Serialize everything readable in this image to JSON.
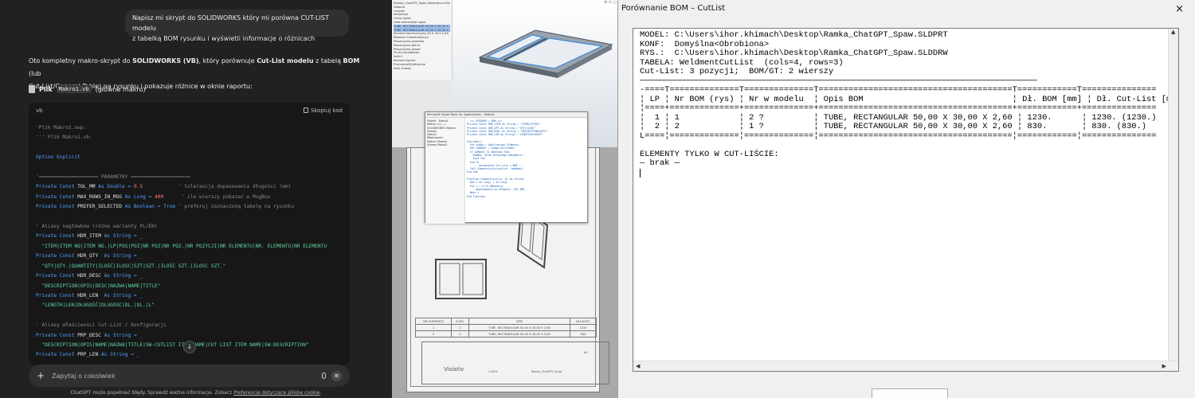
{
  "chat": {
    "user_message_line1": "Napisz mi skrypt do SOLIDWORKS który mi porówna CUT-LIST modelu",
    "user_message_line2": "z tabelką BOM rysunku i wyświetli informacje o różnicach",
    "intro_p1": "Oto kompletny makro-skrypt do ",
    "intro_b1": "SOLIDWORKS (VB)",
    "intro_p2": ", który porównuje ",
    "intro_b2": "Cut-List modelu",
    "intro_p3": " z tabelą ",
    "intro_b3": "BOM",
    "intro_p4": " (lub",
    "intro_line2": "Cut-List/General Table) na rysunku i pokazuje różnice w oknie raportu:",
    "file_label": "Plik",
    "file_name": "Makro1.vb",
    "file_note": "(główne makro)",
    "code_lang": "vb",
    "copy_label": "Skopiuj kod",
    "code_lines": {
      "l01": "'Plik Makro1.swp:",
      "l02": "''' Plik Makro1.vb:",
      "l03": "Option Explicit",
      "l04": "'==================== PARAMETRY ====================",
      "l05a": "Private Const ",
      "l05b": "TOL_MM",
      "l05c": " As Double = ",
      "l05d": "0.5",
      "l05e": "            ' tolerancja dopasowania długości (mm)",
      "l06a": "Private Const ",
      "l06b": "MAX_ROWS_IN_MSG",
      "l06c": " As Long = ",
      "l06d": "400",
      "l06e": "      ' ile wierszy pokazać w MsgBox",
      "l07a": "Private Const ",
      "l07b": "PREFER_SELECTED",
      "l07c": " As Boolean = ",
      "l07d": "True",
      "l07e": " ' preferuj zaznaczoną tabelę na rysunku",
      "l08": "' Aliasy nagłówków (różne warianty PL/EN)",
      "l09a": "Private Const ",
      "l09b": "HDR_ITEM",
      "l09c": " As String = _",
      "l10": "  \"ITEM|ITEM NO|ITEM NO.|LP|POS|POZ|NR POZ|NR POZ.|NR POZYCJI|NR ELEMENTU|NR. ELEMENTU|NR ELEMENTU",
      "l11a": "Private Const ",
      "l11b": "HDR_QTY",
      "l11c": "  As String = _",
      "l12": "  \"QTY|QTY.|QUANTITY|ILOŚĆ|ILOSC|SZT|SZT.|ILOŚĆ SZT.|ILOSC SZT.\"",
      "l13a": "Private Const ",
      "l13b": "HDR_DESC",
      "l13c": " As String = _",
      "l14": "  \"DESCRIPTION|OPIS|DESC|NAZWA|NAME|TITLE\"",
      "l15a": "Private Const ",
      "l15b": "HDR_LEN",
      "l15c": "  As String = _",
      "l16": "  \"LENGTH|LEN|DŁUGOŚĆ|DLUGOSC|DL.|DL.|L\"",
      "l17": "' Aliasy właściwości Cut-List / konfiguracji",
      "l18a": "Private Const ",
      "l18b": "PRP_DESC",
      "l18c": " As String = _",
      "l19": "  \"DESCRIPTION|OPIS|NAME|NAZWA|TITLE|SW-CUTLIST ITEM NAME|CUT LIST ITEM NAME|SW-DESCRIPTION\"",
      "l20a": "Private Const ",
      "l20b": "PRP_LEN",
      "l20c": " As String = _"
    },
    "composer_placeholder": "Zapytaj o cokolwiek",
    "disclaimer_text": "ChatGPT może popełniać błędy. Sprawdź ważne informacje. Zobacz ",
    "disclaimer_link": "Preferencje dotyczące plików cookie",
    "disclaimer_end": "."
  },
  "solidworks": {
    "tree_items": [
      "Ramka_ChatGPT_Spaw (Domyślna<Obrobiona>)",
      "Historia",
      "Czujniki",
      "Adnotacje",
      "Cechy spaw.",
      "Lista elementów spaw.",
      "TUBE, RECTANGULAR 50,00 X 30,00 X 2,60(1)",
      "TUBE, RECTANGULAR 50,00 X 30,00 X 2,60(2)",
      "Element konstrukcyjny 50 X 30 X 2,60",
      "Materiał <nieokreślony>",
      "Płaszczyzna przednia",
      "Płaszczyzna górna",
      "Płaszczyzna prawa",
      "Punkt początkowy",
      "Szkic1",
      "Element konstr.",
      "Przycięcie/Wydłużenie",
      "Szyk liniowy"
    ],
    "macro_title": "Microsoft Visual Basic for Applications - Makro1",
    "macro_left": [
      "Projekt - Makro1",
      "Makro1 (c:\\...)",
      "SOLIDWORKS Objects",
      "Moduły",
      "Makro1",
      "Właściwości",
      "Makro1 Module",
      "(Name) Makro1"
    ],
    "macro_code": [
      "' === RYSUNEK / BOM ===",
      "Private Const HDR_ITEM As String = \"ITEM|LP|POS\"",
      "Private Const HDR_QTY As String = \"QTY|ILOSC\"",
      "Private Const HDR_DESC As String = \"DESCRIPTION|OPIS\"",
      "Private Const HDR_LEN As String = \"LENGTH|DLUGOSC\"",
      "",
      "Sub main()",
      "  Set swApp = Application.SldWorks",
      "  Set swModel = swApp.ActiveDoc",
      "  If swModel Is Nothing Then",
      "    MsgBox \"Brak aktywnego dokumentu.\"",
      "    Exit Sub",
      "  End If",
      "  ' ... porównanie Cut-List z BOM ...",
      "  Call CompareLists(cutList, bomRows)",
      "End Sub",
      "",
      "Function CompareLists(a, b) As String",
      "  Dim i As Long, j As Long",
      "  For i = 0 To UBound(a)",
      "    ' dopasowanie po długości (TOL_MM)",
      "  Next i",
      "End Function"
    ],
    "bom_header": [
      "NR ELEMENTU",
      "ILOŚĆ",
      "OPIS",
      "DŁUGOŚĆ"
    ],
    "bom_rows": [
      [
        "1",
        "2",
        "TUBE, RECTANGULAR 50,00 X 30,00 X 2,60",
        "1230"
      ],
      [
        "2",
        "2",
        "TUBE, RECTANGULAR 50,00 X 30,00 X 2,60",
        "830"
      ]
    ],
    "title_block_logo": "Visiativ",
    "title_block_name": "Ramka_ChatGPT_Spaw",
    "title_block_code": "L.0001",
    "title_block_scale": "A4"
  },
  "dialog": {
    "title": "Porównanie BOM – CutList",
    "close_glyph": "×",
    "report": {
      "model_line": "MODEL: C:\\Users\\ihor.khimach\\Desktop\\Ramka_ChatGPT_Spaw.SLDPRT",
      "konf_line": "KONF:  Domyślna<Obrobiona>",
      "rys_line": "RYS.:  C:\\Users\\ihor.khimach\\Desktop\\Ramka_ChatGPT_Spaw.SLDDRW",
      "tabela_line": "TABELA: WeldmentCutList  (cols=4, rows=3)",
      "summary_line": "Cut-List: 3 pozycji;  BOM/GT: 2 wierszy",
      "separator_line": "────────────────────────────────────────────────────────────────────────────────",
      "table_top": "-====T==============T==============T=======================================T============T===============",
      "table_header": "¦ LP ¦ Nr BOM (rys) ¦ Nr w modelu  ¦ Opis BOM                              ¦ Dł. BOM [mm] ¦ Dł. Cut-List [mm]",
      "table_head_sep": "¦====+==============+==============+=======================================+============+===============",
      "row1": "¦  1 ¦ 1            ¦ 2 ?          ¦ TUBE, RECTANGULAR 50,00 X 30,00 X 2,60 ¦ 1230.      ¦ 1230. (1230.)",
      "row2": "¦  2 ¦ 2            ¦ 1 ?          ¦ TUBE, RECTANGULAR 50,00 X 30,00 X 2,60 ¦ 830.       ¦ 830. (830.)",
      "table_bottom": "L====¦==============¦==============¦=======================================¦============¦===============",
      "blank": " ",
      "only_cutlist_header": "ELEMENTY TYLKO W CUT-LIŚCIE:",
      "only_cutlist_value": "— brak —"
    }
  }
}
